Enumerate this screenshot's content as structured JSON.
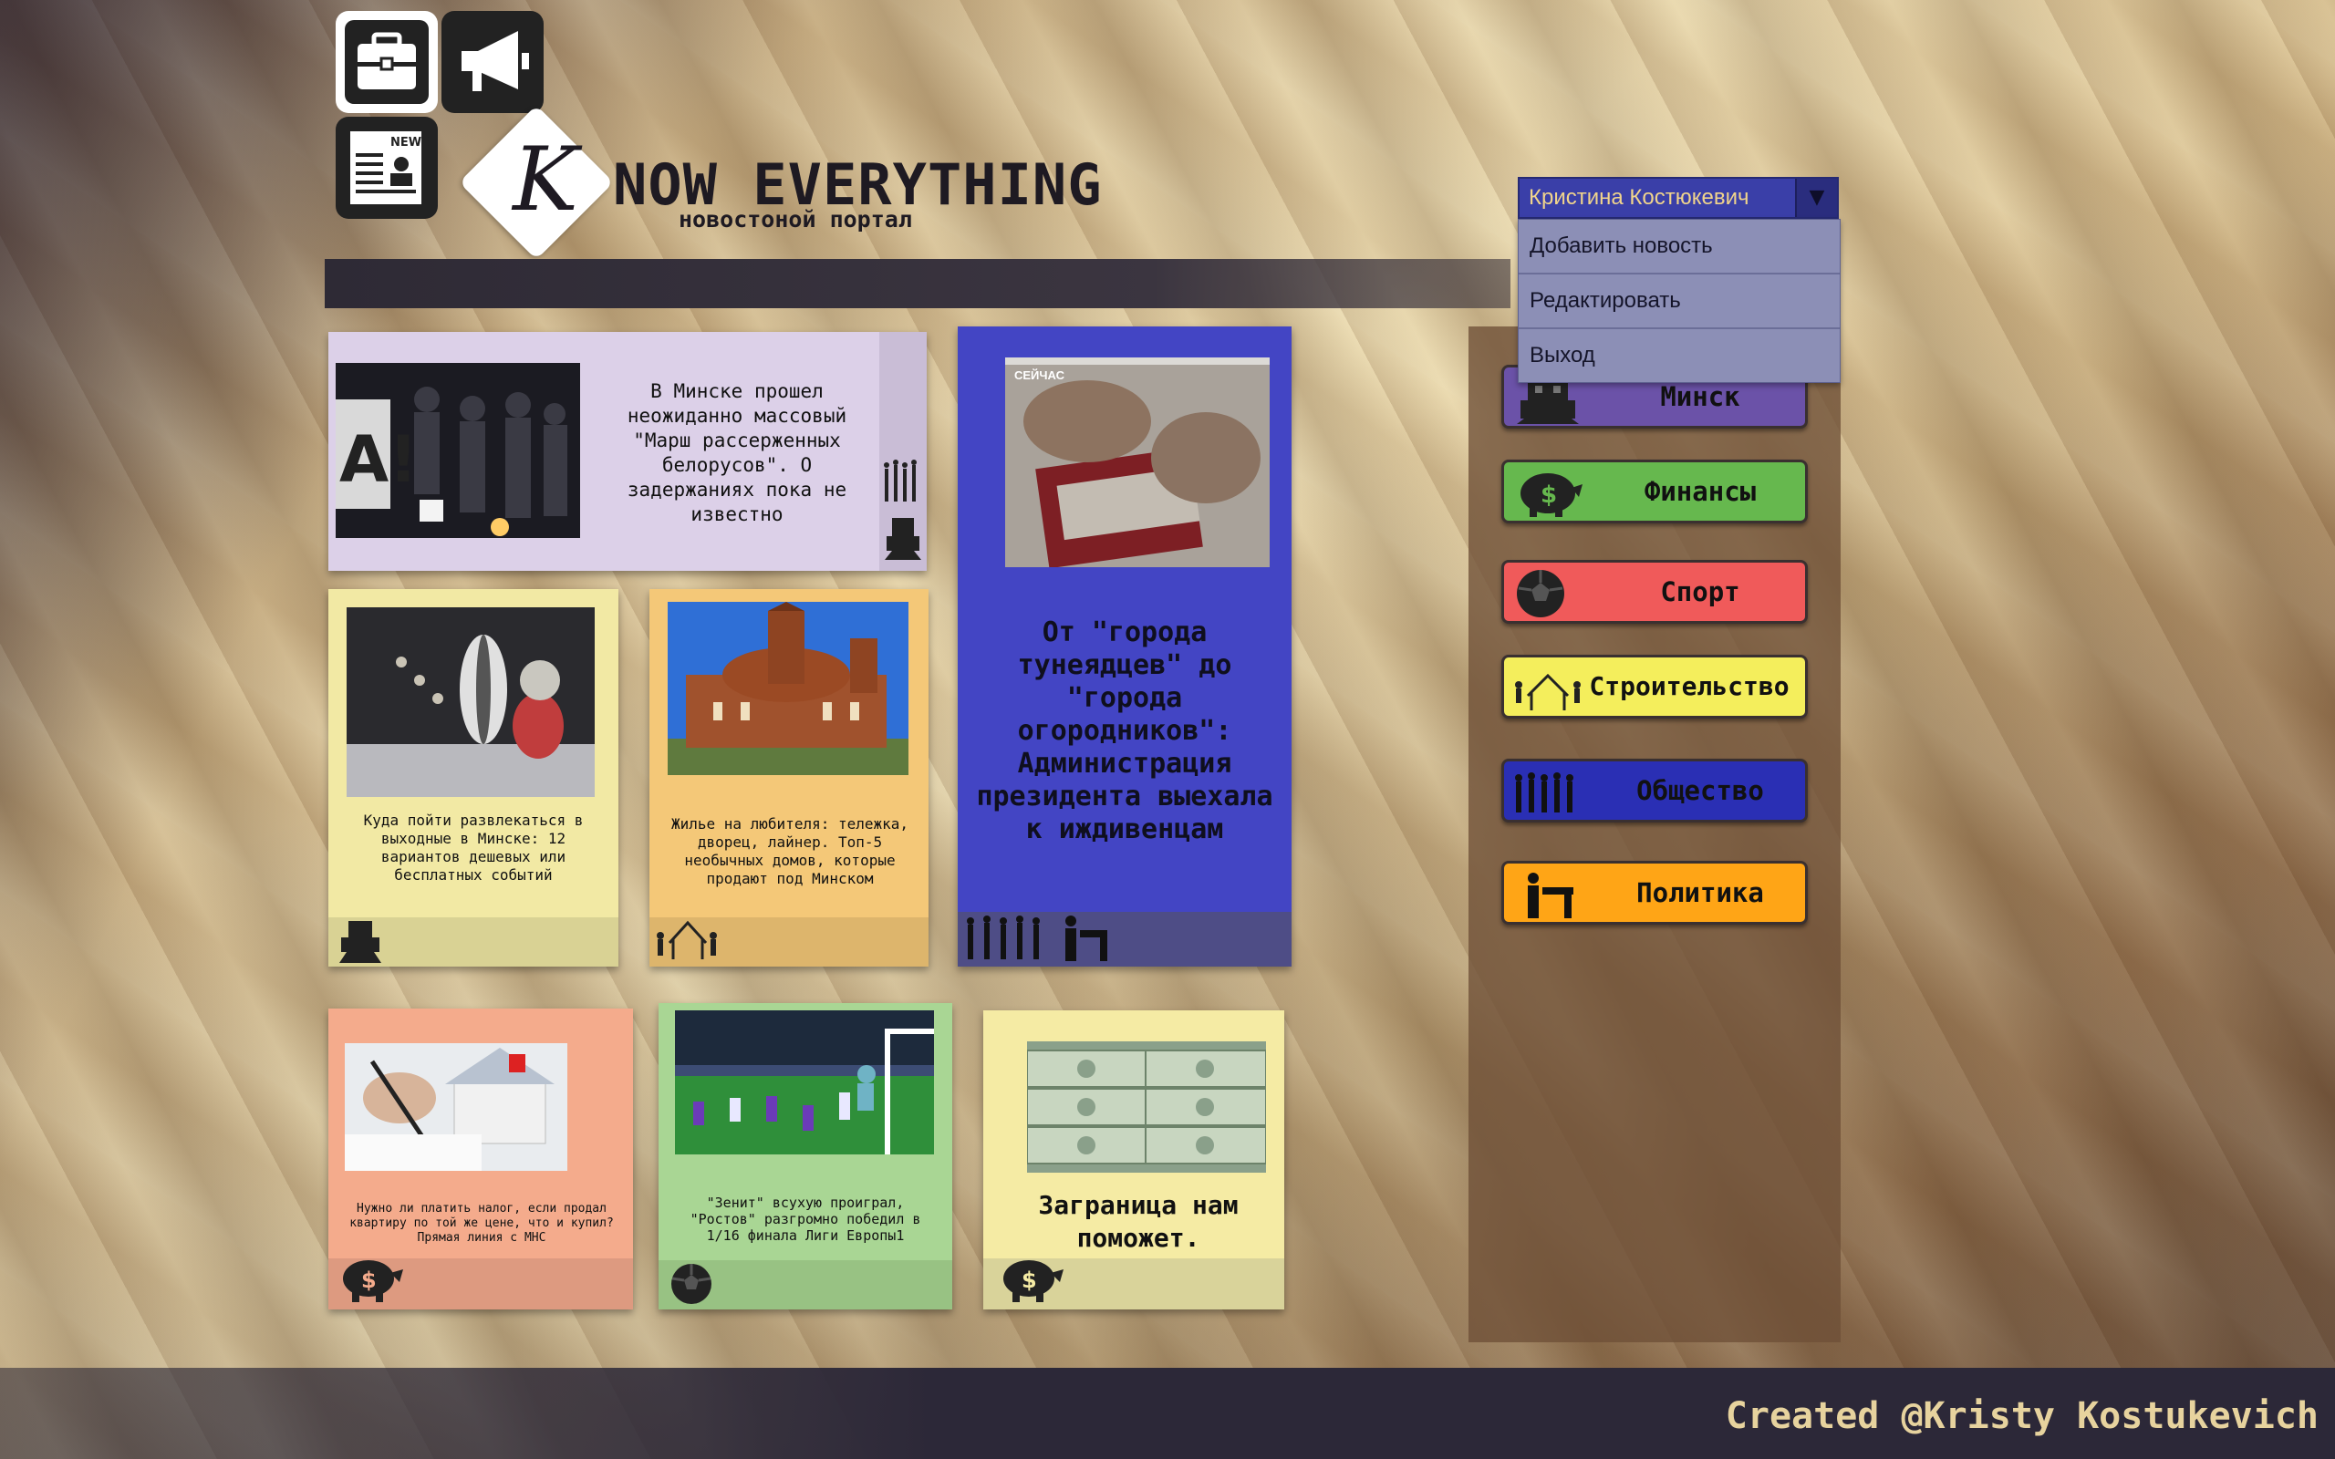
{
  "brand": {
    "title": "NOW EVERYTHING",
    "subtitle": "новостоной портал",
    "logo_letter": "K"
  },
  "user_menu": {
    "username": "Кристина Костюкевич",
    "items": [
      "Добавить новость",
      "Редактировать",
      "Выход"
    ]
  },
  "categories": [
    {
      "label": "Минск",
      "color": "#6b52a8",
      "icon": "building-icon"
    },
    {
      "label": "Финансы",
      "color": "#66b84e",
      "icon": "piggy-bank-icon"
    },
    {
      "label": "Спорт",
      "color": "#f05a5a",
      "icon": "soccer-ball-icon"
    },
    {
      "label": "Строительство",
      "color": "#f4ee5c",
      "icon": "construction-icon"
    },
    {
      "label": "Общество",
      "color": "#2a2fb4",
      "icon": "crowd-icon"
    },
    {
      "label": "Политика",
      "color": "#ffa516",
      "icon": "speaker-icon"
    }
  ],
  "news": [
    {
      "text": "В Минске прошел неожиданно массовый \"Марш рассерженных белорусов\". О задержаниях пока не известно"
    },
    {
      "text": "От \"города тунеядцев\" до \"города огородников\": Администрация президента выехала к иждивенцам",
      "img_label": "СЕЙЧАС"
    },
    {
      "text": "Куда пойти развлекаться в выходные в Минске: 12 вариантов дешевых или бесплатных событий"
    },
    {
      "text": "Жилье на любителя: тележка, дворец, лайнер. Топ-5 необычных домов, которые продают под Минском"
    },
    {
      "text": "Нужно ли платить налог, если продал квартиру по той же цене, что и купил? Прямая линия с МНС"
    },
    {
      "text": "\"Зенит\" всухую проиграл, \"Ростов\" разгромно победил в 1/16 финала Лиги Европы1"
    },
    {
      "text": "Заграница нам поможет."
    }
  ],
  "footer": {
    "text": "Created  @Kristy Kostukevich"
  }
}
